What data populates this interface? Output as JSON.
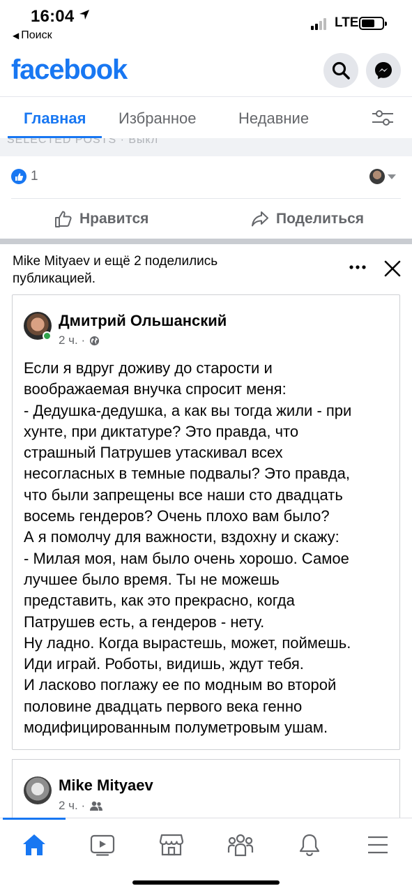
{
  "status_bar": {
    "time": "16:04",
    "back_label": "Поиск",
    "network": "LTE",
    "back_arrow": "◀"
  },
  "header": {
    "logo": "facebook",
    "icons": [
      "search-icon",
      "messenger-icon"
    ]
  },
  "tabs": {
    "items": [
      "Главная",
      "Избранное",
      "Недавние"
    ],
    "active": "Главная",
    "filter_icon": "sliders-icon"
  },
  "previous_post": {
    "ghost_text": "SELECTED POSTS · Выкл",
    "like_count": "1",
    "like_label": "Нравится",
    "share_label": "Поделиться"
  },
  "shared_post": {
    "header_text": "Mike Mityaev и ещё 2 поделились публикацией.",
    "author": "Дмитрий Ольшанский",
    "time": "2 ч. ·",
    "privacy_icon": "globe-icon",
    "body_lines": [
      "Если я вдруг доживу до старости и",
      "воображаемая внучка спросит меня:",
      "- Дедушка-дедушка, а как вы тогда жили - при",
      "хунте, при диктатуре? Это правда, что",
      "страшный Патрушев утаскивал всех",
      "несогласных в темные подвалы? Это правда,",
      "что были запрещены все наши сто двадцать",
      "восемь гендеров? Очень плохо вам было?",
      "А я помолчу для важности, вздохну и скажу:",
      "- Милая моя, нам было очень хорошо. Самое",
      "лучшее было время. Ты не можешь",
      "представить, как это прекрасно, когда",
      "Патрушев есть, а гендеров - нету.",
      "Ну ладно. Когда вырастешь, может, поймешь.",
      "Иди играй. Роботы, видишь, ждут тебя.",
      "И ласково поглажу ее по модным во второй",
      "половине двадцать первого века генно",
      "модифицированным полуметровым ушам."
    ]
  },
  "reshare": {
    "author": "Mike Mityaev",
    "time": "2 ч. ·",
    "privacy_icon": "friends-icon"
  },
  "bottom_nav": {
    "items": [
      "home-icon",
      "watch-icon",
      "marketplace-icon",
      "groups-icon",
      "notifications-icon",
      "menu-icon"
    ],
    "active": "home-icon"
  },
  "colors": {
    "brand": "#1877f2",
    "secondary_text": "#65676b",
    "online": "#31a24c"
  }
}
